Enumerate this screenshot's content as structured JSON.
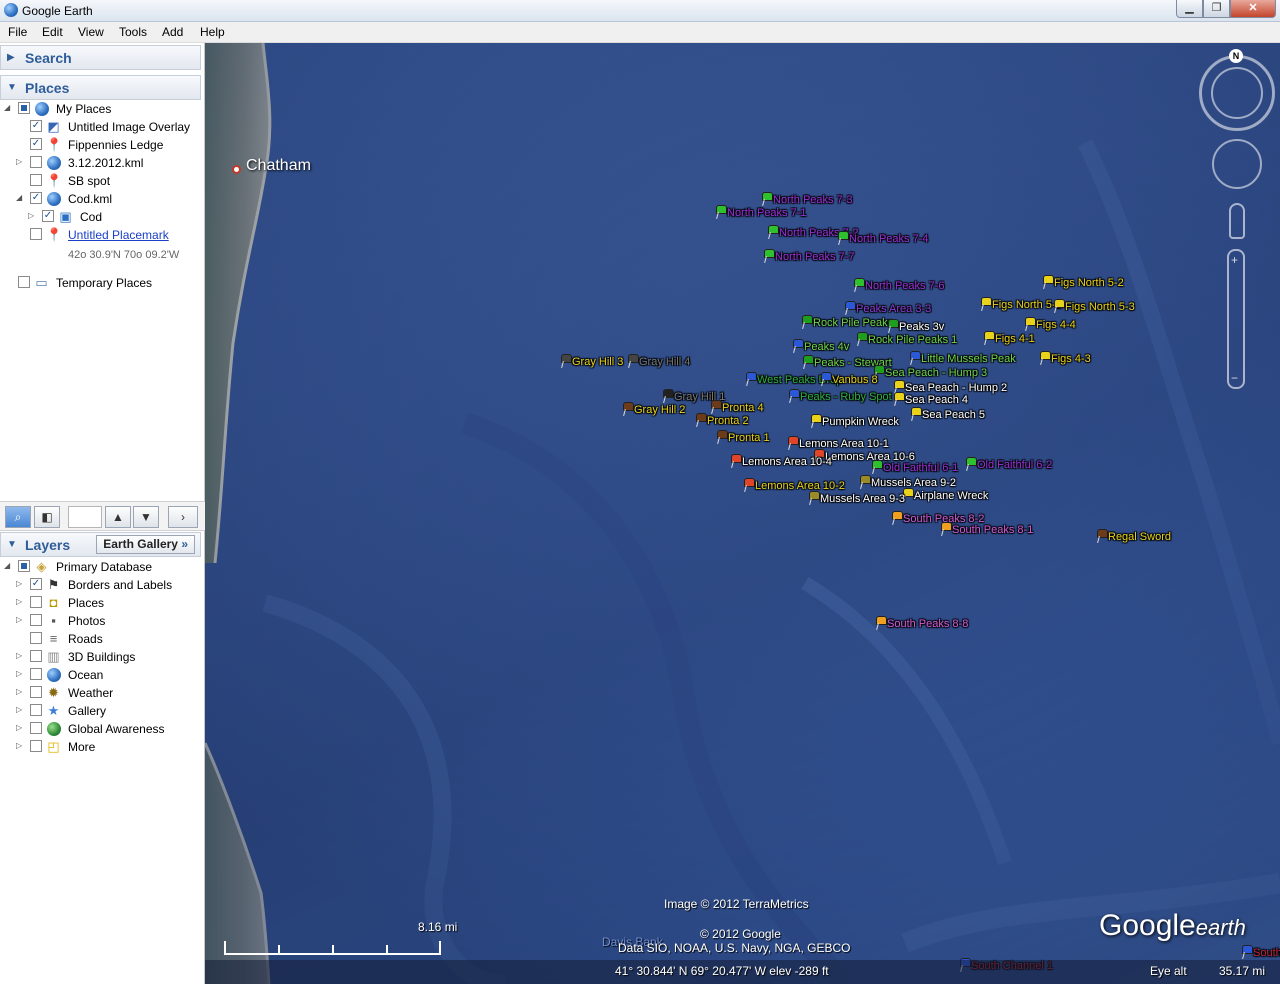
{
  "window": {
    "title": "Google Earth"
  },
  "menu": [
    "File",
    "Edit",
    "View",
    "Tools",
    "Add",
    "Help"
  ],
  "search_panel": {
    "label": "Search"
  },
  "places_panel": {
    "label": "Places",
    "items": [
      {
        "label": "My Places",
        "icon": "my-places-globe-icon",
        "checkbox": "partial",
        "expander": "expanded"
      },
      {
        "label": "Untitled Image Overlay",
        "icon": "image-overlay-icon",
        "checkbox": "checked"
      },
      {
        "label": "Fippennies Ledge",
        "icon": "yellow-pushpin-icon",
        "checkbox": "checked"
      },
      {
        "label": "3.12.2012.kml",
        "icon": "kml-globe-icon",
        "checkbox": "unchecked",
        "expander": "collapsed"
      },
      {
        "label": "SB spot",
        "icon": "orange-pushpin-icon",
        "checkbox": "unchecked"
      },
      {
        "label": "Cod.kml",
        "icon": "kml-globe-icon",
        "checkbox": "checked",
        "expander": "expanded"
      },
      {
        "label": "Cod",
        "icon": "cod-image-icon",
        "checkbox": "checked",
        "expander": "collapsed"
      },
      {
        "label": "Untitled Placemark",
        "icon": "yellow-pushpin-icon",
        "checkbox": "unchecked"
      },
      {
        "label": "42o 30.9'N 70o 09.2'W"
      },
      {
        "label": "Temporary Places",
        "icon": "folder-icon",
        "checkbox": "unchecked"
      }
    ]
  },
  "layers_panel": {
    "label": "Layers",
    "gallery_button": "Earth Gallery",
    "gallery_arrows": "»",
    "items": [
      {
        "label": "Primary Database",
        "icon": "database-icon",
        "checkbox": "partial",
        "expander": "expanded"
      },
      {
        "label": "Borders and Labels",
        "icon": "borders-flag-icon",
        "checkbox": "checked",
        "expander": "collapsed"
      },
      {
        "label": "Places",
        "icon": "places-square-icon",
        "checkbox": "unchecked",
        "expander": "collapsed"
      },
      {
        "label": "Photos",
        "icon": "camera-icon",
        "checkbox": "unchecked",
        "expander": "collapsed"
      },
      {
        "label": "Roads",
        "icon": "road-icon",
        "checkbox": "unchecked"
      },
      {
        "label": "3D Buildings",
        "icon": "building-icon",
        "checkbox": "unchecked",
        "expander": "collapsed"
      },
      {
        "label": "Ocean",
        "icon": "ocean-globe-icon",
        "checkbox": "unchecked",
        "expander": "collapsed"
      },
      {
        "label": "Weather",
        "icon": "sun-gear-icon",
        "checkbox": "unchecked",
        "expander": "collapsed"
      },
      {
        "label": "Gallery",
        "icon": "star-icon",
        "checkbox": "unchecked",
        "expander": "collapsed"
      },
      {
        "label": "Global Awareness",
        "icon": "awareness-globe-icon",
        "checkbox": "unchecked",
        "expander": "collapsed"
      },
      {
        "label": "More",
        "icon": "more-note-icon",
        "checkbox": "unchecked",
        "expander": "collapsed"
      }
    ]
  },
  "map": {
    "town_label": "Chatham",
    "compass_letter": "N",
    "attribution_image": "Image © 2012 TerraMetrics",
    "attribution_copyright": "© 2012 Google",
    "attribution_data": "Data SIO, NOAA, U.S. Navy, NGA, GEBCO",
    "hidden_label": "Davis Bank",
    "scale_label": "8.16 mi",
    "logo_word1": "Google",
    "logo_word2": "earth",
    "status": {
      "coords": "41° 30.844' N  69° 20.477' W  elev  -289 ft",
      "eye_label": "Eye alt",
      "eye_value": "35.17 mi"
    },
    "placemarks": [
      {
        "label": "North Peaks 7-3",
        "color": "#9b2fd6",
        "pin": "#2ec02e"
      },
      {
        "label": "North Peaks 7-1",
        "color": "#9b2fd6",
        "pin": "#2ec02e"
      },
      {
        "label": "North Peaks 7-2",
        "color": "#9b2fd6",
        "pin": "#2ec02e"
      },
      {
        "label": "North Peaks 7-4",
        "color": "#9b2fd6",
        "pin": "#2ec02e"
      },
      {
        "label": "North Peaks 7-7",
        "color": "#9b2fd6",
        "pin": "#2ec02e"
      },
      {
        "label": "North Peaks 7-6",
        "color": "#9b2fd6",
        "pin": "#2ec02e"
      },
      {
        "label": "Figs North 5-2",
        "color": "#e9d21a",
        "pin": "#e9d21a"
      },
      {
        "label": "Figs North 5-1",
        "color": "#e9d21a",
        "pin": "#e9d21a"
      },
      {
        "label": "Figs North 5-3",
        "color": "#e9d21a",
        "pin": "#e9d21a"
      },
      {
        "label": "Peaks Area 3-3",
        "color": "#8a3bd0",
        "pin": "#2b58d6"
      },
      {
        "label": "Rock Pile Peaks",
        "color": "#6fd64a",
        "pin": "#1e9d1e"
      },
      {
        "label": "Peaks 3v",
        "color": "#ffffff",
        "pin": "#1e9d1e"
      },
      {
        "label": "Figs 4-4",
        "color": "#e9d21a",
        "pin": "#e9d21a"
      },
      {
        "label": "Figs 4-1",
        "color": "#e9d21a",
        "pin": "#e9d21a"
      },
      {
        "label": "Rock Pile Peaks 1",
        "color": "#6fd64a",
        "pin": "#1e9d1e"
      },
      {
        "label": "Peaks 4v",
        "color": "#6fd64a",
        "pin": "#2b58d6"
      },
      {
        "label": "Little Mussels Peak",
        "color": "#6fd64a",
        "pin": "#2b58d6"
      },
      {
        "label": "Figs 4-3",
        "color": "#e9d21a",
        "pin": "#e9d21a"
      },
      {
        "label": "Peaks - Stewart",
        "color": "#6fd64a",
        "pin": "#1e9d1e"
      },
      {
        "label": "Sea Peach - Hump 3",
        "color": "#6fd64a",
        "pin": "#1e9d1e"
      },
      {
        "label": "Gray Hill 3",
        "color": "#e9d21a",
        "pin": "#444444"
      },
      {
        "label": "Gray Hill 4",
        "color": "#777777",
        "pin": "#444444"
      },
      {
        "label": "West Peaks Drop",
        "color": "#2fae3f",
        "pin": "#2b58d6"
      },
      {
        "label": "Vanbus 8",
        "color": "#e9d21a",
        "pin": "#2b58d6"
      },
      {
        "label": "Sea Peach - Hump 2",
        "color": "#ffffff",
        "pin": "#e9d21a"
      },
      {
        "label": "Peaks - Ruby Spot",
        "color": "#2fae3f",
        "pin": "#2b58d6"
      },
      {
        "label": "Gray Hill 1",
        "color": "#777777",
        "pin": "#222222"
      },
      {
        "label": "Sea Peach 4",
        "color": "#ffffff",
        "pin": "#e9d21a"
      },
      {
        "label": "Gray Hill 2",
        "color": "#e9d21a",
        "pin": "#6b3b1a"
      },
      {
        "label": "Pronta 4",
        "color": "#e9d21a",
        "pin": "#6b3b1a"
      },
      {
        "label": "Sea Peach 5",
        "color": "#ffffff",
        "pin": "#e9d21a"
      },
      {
        "label": "Pronta 2",
        "color": "#e9d21a",
        "pin": "#6b3b1a"
      },
      {
        "label": "Pumpkin Wreck",
        "color": "#ffffff",
        "pin": "#e9d21a"
      },
      {
        "label": "Pronta 1",
        "color": "#e9d21a",
        "pin": "#6b3b1a"
      },
      {
        "label": "Lemons Area 10-1",
        "color": "#ffffff",
        "pin": "#e0452a"
      },
      {
        "label": "Lemons Area 10-6",
        "color": "#ffffff",
        "pin": "#e0452a"
      },
      {
        "label": "Lemons Area 10-4",
        "color": "#ffffff",
        "pin": "#e0452a"
      },
      {
        "label": "Old Faithful 6-1",
        "color": "#9b2fd6",
        "pin": "#2ec02e"
      },
      {
        "label": "Old Faithful 6-2",
        "color": "#9b2fd6",
        "pin": "#2ec02e"
      },
      {
        "label": "Mussels Area 9-2",
        "color": "#ffffff",
        "pin": "#9a8b2a"
      },
      {
        "label": "Lemons Area 10-2",
        "color": "#e9d21a",
        "pin": "#e0452a"
      },
      {
        "label": "Airplane Wreck",
        "color": "#ffffff",
        "pin": "#e9d21a"
      },
      {
        "label": "Mussels Area 9-3",
        "color": "#ffffff",
        "pin": "#9a8b2a"
      },
      {
        "label": "South Peaks 8-2",
        "color": "#d25bd6",
        "pin": "#f0a020"
      },
      {
        "label": "South Peaks 8-1",
        "color": "#d25bd6",
        "pin": "#f0a020"
      },
      {
        "label": "Regal Sword",
        "color": "#e9d21a",
        "pin": "#6b3b1a"
      },
      {
        "label": "South Peaks 8-8",
        "color": "#d25bd6",
        "pin": "#f0a020"
      },
      {
        "label": "South Channel 1",
        "color": "#c0243a",
        "pin": "#2b58d6"
      },
      {
        "label": "South C",
        "color": "#c0243a",
        "pin": "#2b58d6"
      }
    ]
  }
}
